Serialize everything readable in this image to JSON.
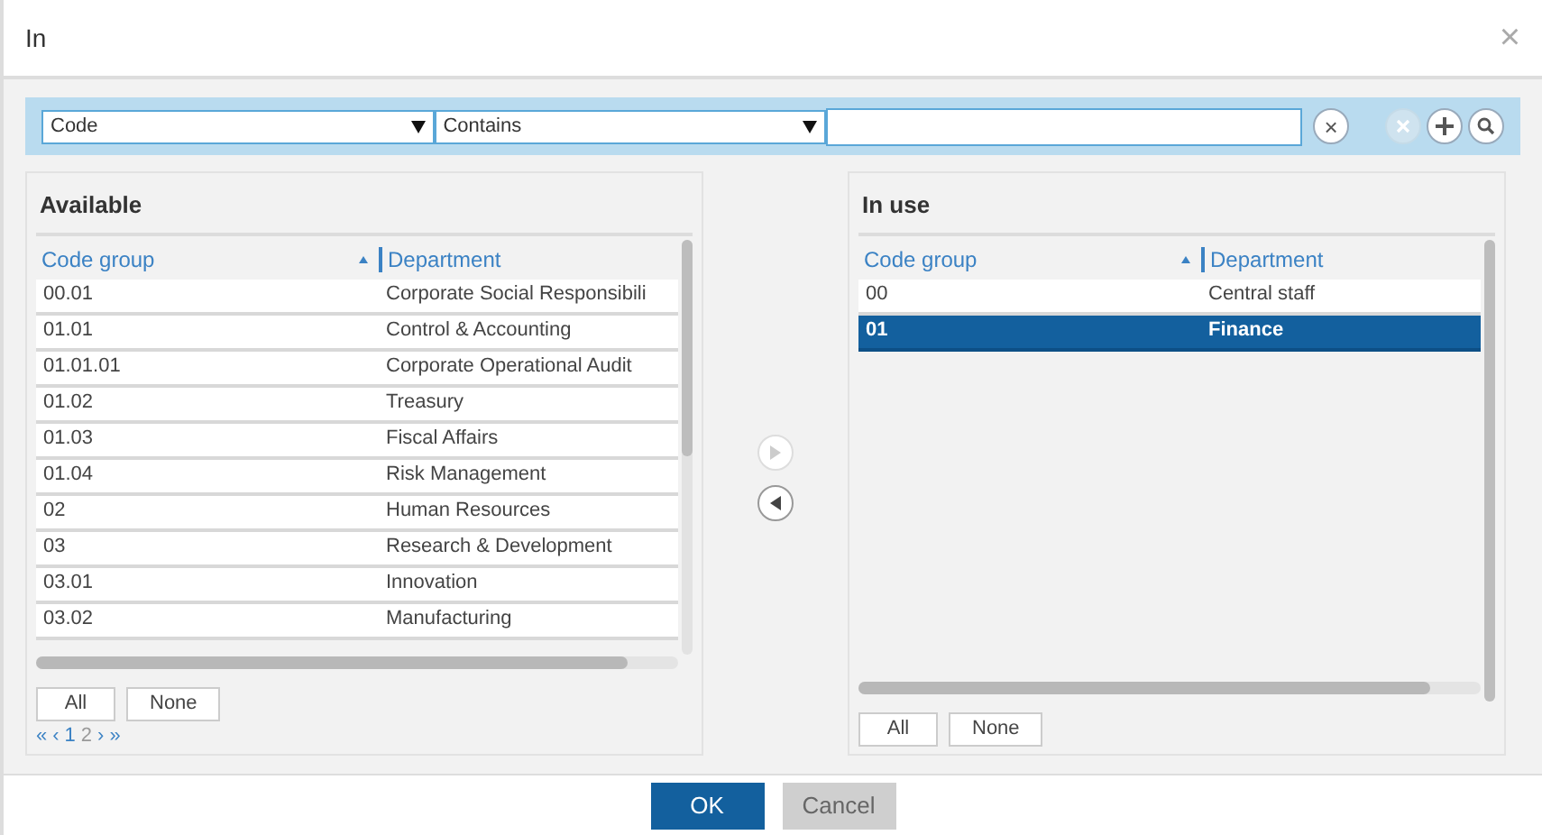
{
  "window": {
    "title": "In",
    "close": "×"
  },
  "filter": {
    "field": "Code",
    "operator": "Contains",
    "clear": "×"
  },
  "available": {
    "title": "Available",
    "columns": [
      {
        "label": "Code group",
        "sorted": true
      },
      {
        "label": "Department",
        "sorted": false
      }
    ],
    "rows": [
      {
        "code": "00.01",
        "department": "Corporate Social Responsibili",
        "selected": false
      },
      {
        "code": "01.01",
        "department": "Control & Accounting",
        "selected": false
      },
      {
        "code": "01.01.01",
        "department": "Corporate Operational Audit",
        "selected": false
      },
      {
        "code": "01.02",
        "department": "Treasury",
        "selected": false
      },
      {
        "code": "01.03",
        "department": "Fiscal Affairs",
        "selected": false
      },
      {
        "code": "01.04",
        "department": "Risk Management",
        "selected": false
      },
      {
        "code": "02",
        "department": "Human Resources",
        "selected": false
      },
      {
        "code": "03",
        "department": "Research & Development",
        "selected": false
      },
      {
        "code": "03.01",
        "department": "Innovation",
        "selected": false
      },
      {
        "code": "03.02",
        "department": "Manufacturing",
        "selected": false
      }
    ],
    "buttons": [
      "All",
      "None"
    ],
    "pager": [
      {
        "label": "«",
        "kind": "nav"
      },
      {
        "label": "‹",
        "kind": "nav"
      },
      {
        "label": "1",
        "kind": "page",
        "selected": true
      },
      {
        "label": "2",
        "kind": "page",
        "selected": false
      },
      {
        "label": "›",
        "kind": "nav"
      },
      {
        "label": "»",
        "kind": "nav"
      }
    ]
  },
  "move": [
    {
      "kind": "right",
      "disabled": true
    },
    {
      "kind": "left",
      "disabled": false
    }
  ],
  "in_use": {
    "title": "In use",
    "columns": [
      {
        "label": "Code group",
        "sorted": true
      },
      {
        "label": "Department",
        "sorted": false
      }
    ],
    "rows": [
      {
        "code": "00",
        "department": "Central staff",
        "selected": false
      },
      {
        "code": "01",
        "department": "Finance",
        "selected": true
      }
    ],
    "buttons": [
      "All",
      "None"
    ]
  },
  "footer": [
    {
      "label": "OK",
      "kind": "primary"
    },
    {
      "label": "Cancel",
      "kind": "secondary"
    }
  ]
}
